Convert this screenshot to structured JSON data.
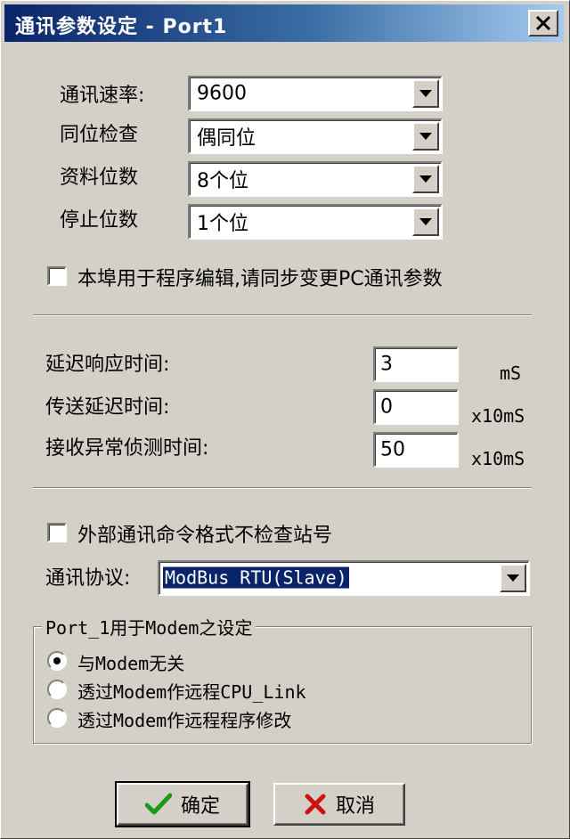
{
  "window": {
    "title": "通讯参数设定 - Port1",
    "close_symbol": "X"
  },
  "comm": {
    "baud_label": "通讯速率:",
    "baud_value": "9600",
    "parity_label": "同位检查",
    "parity_value": "偶同位",
    "databits_label": "资料位数",
    "databits_value": "8个位",
    "stopbits_label": "停止位数",
    "stopbits_value": "1个位"
  },
  "sync_checkbox": {
    "label": "本埠用于程序编辑,请同步变更PC通讯参数",
    "checked": false
  },
  "timing": {
    "delay_response_label": "延迟响应时间:",
    "delay_response_value": "3",
    "delay_response_unit": "mS",
    "transmit_delay_label": "传送延迟时间:",
    "transmit_delay_value": "0",
    "transmit_delay_unit": "x10mS",
    "receive_error_label": "接收异常侦测时间:",
    "receive_error_value": "50",
    "receive_error_unit": "x10mS"
  },
  "station_checkbox": {
    "label": "外部通讯命令格式不检查站号",
    "checked": false
  },
  "protocol": {
    "label": "通讯协议:",
    "value": "ModBus RTU(Slave)"
  },
  "modem_group": {
    "title": "Port_1用于Modem之设定",
    "options": [
      {
        "label": "与Modem无关",
        "selected": true
      },
      {
        "label": "透过Modem作远程CPU_Link",
        "selected": false
      },
      {
        "label": "透过Modem作远程程序修改",
        "selected": false
      }
    ]
  },
  "buttons": {
    "ok_label": "确定",
    "cancel_label": "取消"
  },
  "colors": {
    "titlebar_start": "#0a246a",
    "ok_icon": "#1a9a1a",
    "cancel_icon": "#cc1111"
  }
}
